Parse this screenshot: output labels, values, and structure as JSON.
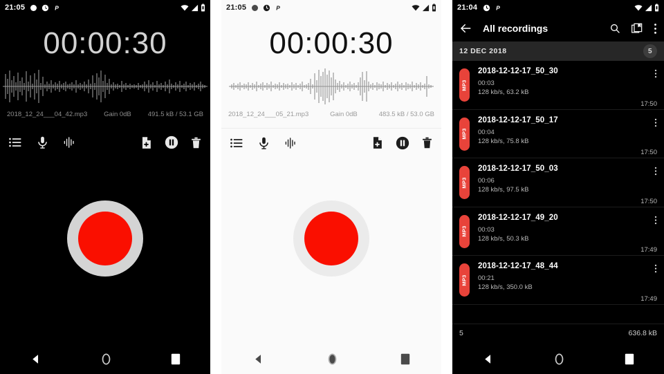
{
  "colors": {
    "record_red": "#fa0f00",
    "chip_red": "#e8433a",
    "dark_bg": "#000000",
    "light_bg": "#fafafa",
    "date_band": "#272727"
  },
  "panel_recorder_dark": {
    "status_bar": {
      "time": "21:05",
      "icons_left": [
        "record-dot-icon",
        "clock-icon",
        "parking-p-icon"
      ],
      "icons_right": [
        "wifi-icon",
        "signal-icon",
        "battery-icon"
      ]
    },
    "timer": "00:00:30",
    "meta": {
      "filename": "2018_12_24___04_42.mp3",
      "gain": "Gain 0dB",
      "size": "491.5 kB / 53.1 GB"
    },
    "toolbar": {
      "left": [
        {
          "name": "recordings-list-icon",
          "label": "Recordings list"
        },
        {
          "name": "microphone-icon",
          "label": "Microphone"
        },
        {
          "name": "waveform-icon",
          "label": "Waveform"
        }
      ],
      "right": [
        {
          "name": "new-file-icon",
          "label": "New file"
        },
        {
          "name": "pause-icon",
          "label": "Pause"
        },
        {
          "name": "delete-icon",
          "label": "Delete"
        }
      ]
    },
    "record_button": "record-button",
    "navbar": [
      "back-nav-icon",
      "home-nav-icon",
      "recents-nav-icon"
    ]
  },
  "panel_recorder_light": {
    "status_bar": {
      "time": "21:05",
      "icons_left": [
        "record-dot-icon",
        "clock-icon",
        "parking-p-icon"
      ],
      "icons_right": [
        "wifi-icon",
        "signal-icon",
        "battery-icon"
      ]
    },
    "timer": "00:00:30",
    "meta": {
      "filename": "2018_12_24___05_21.mp3",
      "gain": "Gain 0dB",
      "size": "483.5 kB / 53.0 GB"
    },
    "toolbar": {
      "left": [
        {
          "name": "recordings-list-icon",
          "label": "Recordings list"
        },
        {
          "name": "microphone-icon",
          "label": "Microphone"
        },
        {
          "name": "waveform-icon",
          "label": "Waveform"
        }
      ],
      "right": [
        {
          "name": "new-file-icon",
          "label": "New file"
        },
        {
          "name": "pause-icon",
          "label": "Pause"
        },
        {
          "name": "delete-icon",
          "label": "Delete"
        }
      ]
    },
    "record_button": "record-button",
    "navbar": [
      "back-nav-icon",
      "home-nav-icon",
      "recents-nav-icon"
    ]
  },
  "panel_recordings_list": {
    "status_bar": {
      "time": "21:04",
      "icons_left": [
        "clock-icon",
        "parking-p-icon"
      ],
      "icons_right": [
        "wifi-icon",
        "signal-icon",
        "battery-icon"
      ]
    },
    "appbar": {
      "back": "back-arrow-icon",
      "title": "All recordings",
      "actions": [
        "search-icon",
        "library-icon",
        "overflow-menu-icon"
      ]
    },
    "date_header": {
      "label": "12 DEC 2018",
      "count": "5"
    },
    "rows": [
      {
        "format": "MP3",
        "title": "2018-12-12-17_50_30",
        "duration": "00:03",
        "info": "128 kb/s, 63.2 kB",
        "time": "17:50"
      },
      {
        "format": "MP3",
        "title": "2018-12-12-17_50_17",
        "duration": "00:04",
        "info": "128 kb/s, 75.8 kB",
        "time": "17:50"
      },
      {
        "format": "MP3",
        "title": "2018-12-12-17_50_03",
        "duration": "00:06",
        "info": "128 kb/s, 97.5 kB",
        "time": "17:50"
      },
      {
        "format": "MP3",
        "title": "2018-12-12-17_49_20",
        "duration": "00:03",
        "info": "128 kb/s, 50.3 kB",
        "time": "17:49"
      },
      {
        "format": "MP3",
        "title": "2018-12-12-17_48_44",
        "duration": "00:21",
        "info": "128 kb/s, 350.0 kB",
        "time": "17:49"
      }
    ],
    "footer": {
      "count": "5",
      "total_size": "636.8 kB"
    },
    "navbar": [
      "back-nav-icon",
      "home-nav-icon",
      "recents-nav-icon"
    ]
  }
}
